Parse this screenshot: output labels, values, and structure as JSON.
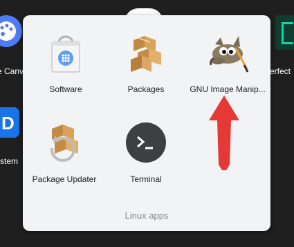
{
  "background_apps": {
    "left_top_label": "e Canv",
    "left_bottom_label": "stem",
    "right_top_label": "erfect"
  },
  "folder": {
    "title": "Linux apps",
    "apps": [
      {
        "label": "Software",
        "icon": "software-bag-icon"
      },
      {
        "label": "Packages",
        "icon": "packages-boxes-icon"
      },
      {
        "label": "GNU Image Manip...",
        "icon": "gimp-wilber-icon"
      },
      {
        "label": "Package Updater",
        "icon": "package-updater-icon"
      },
      {
        "label": "Terminal",
        "icon": "terminal-prompt-icon"
      }
    ]
  },
  "annotation": {
    "icon": "red-up-arrow",
    "color": "#e53935"
  },
  "colors": {
    "desktop_bg": "#1f1f1f",
    "folder_bg": "#f1f3f4",
    "terminal_bg": "#3c4043"
  }
}
